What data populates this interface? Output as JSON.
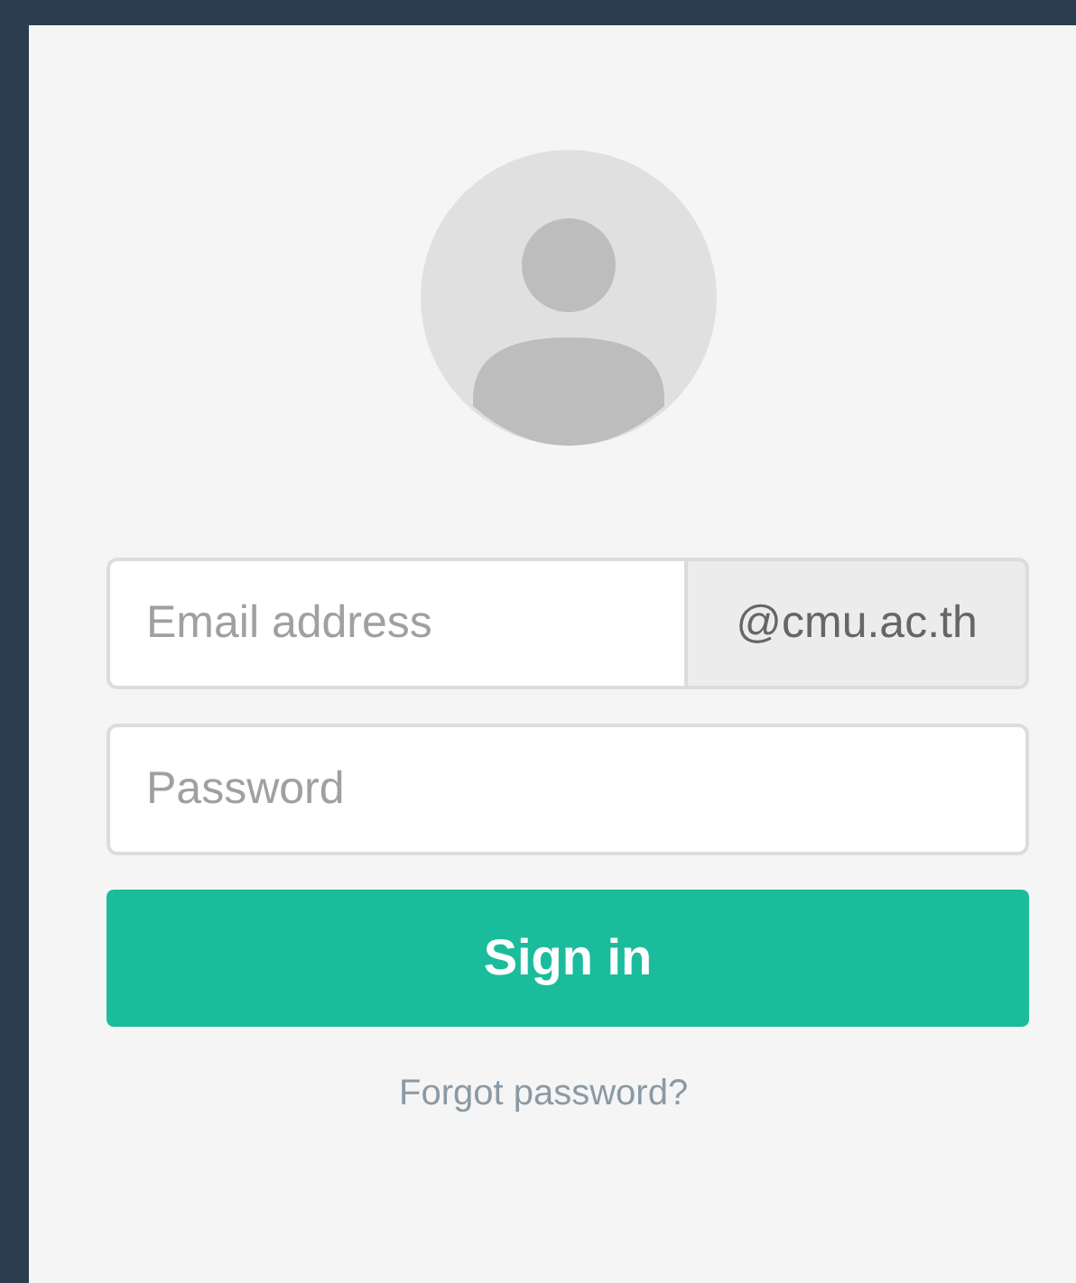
{
  "login_form": {
    "email": {
      "placeholder": "Email address",
      "domain_suffix": "@cmu.ac.th"
    },
    "password": {
      "placeholder": "Password"
    },
    "sign_in_button": "Sign in",
    "forgot_password_link": "Forgot password?"
  }
}
